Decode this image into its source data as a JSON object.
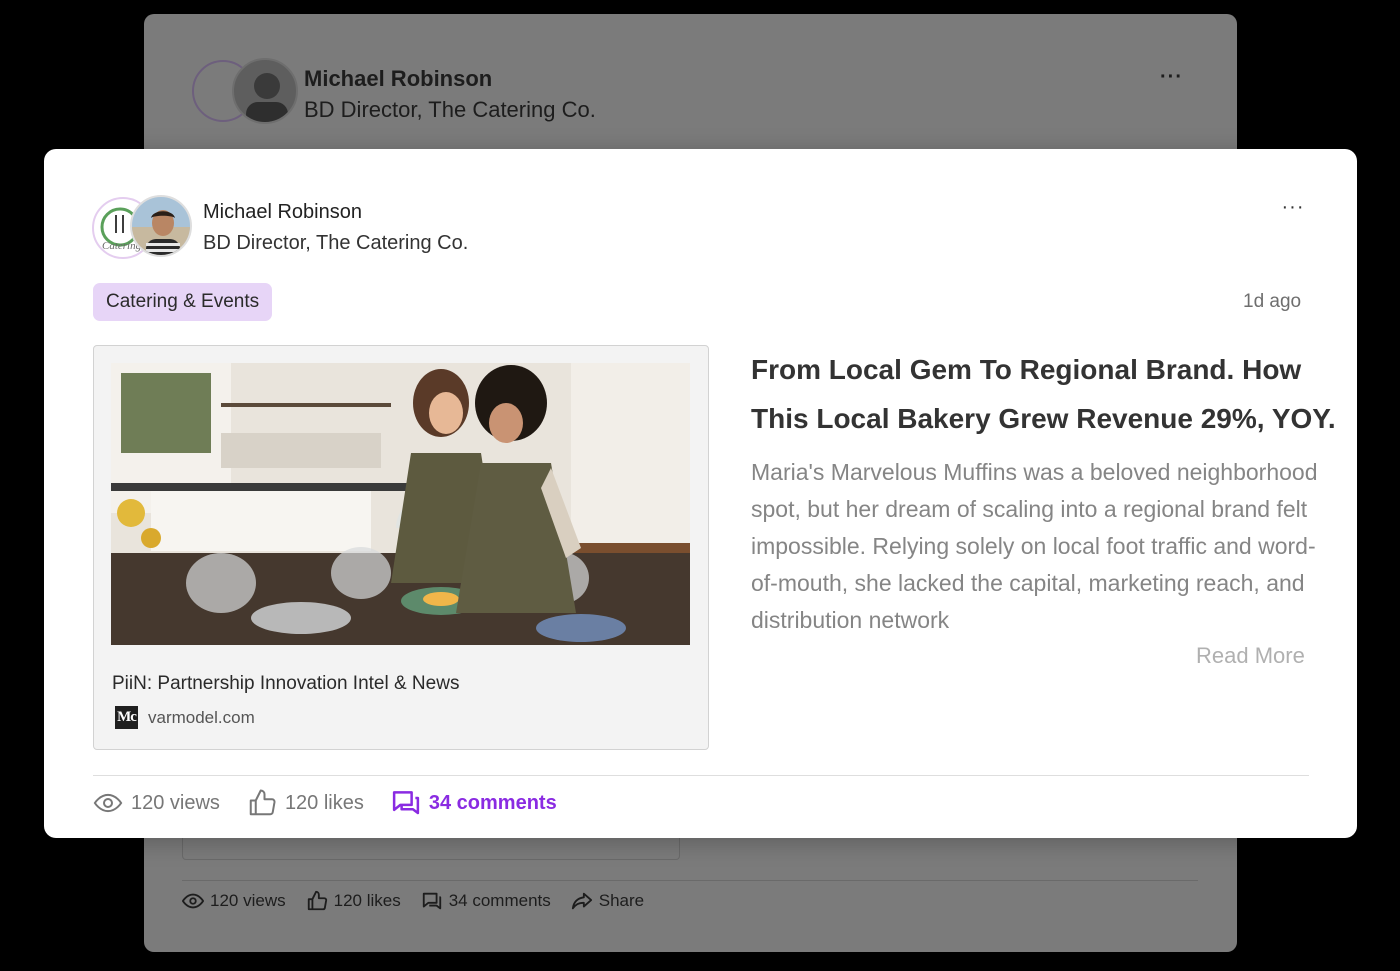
{
  "background_post": {
    "author_name": "Michael Robinson",
    "author_title": "BD Director, The Catering Co.",
    "menu_label": "···",
    "stats": {
      "views": "120 views",
      "likes": "120 likes",
      "comments": "34 comments",
      "share": "Share"
    }
  },
  "post": {
    "author_name": "Michael Robinson",
    "author_title": "BD Director, The Catering Co.",
    "logo_text": "Catering",
    "menu_label": "···",
    "tag": "Catering & Events",
    "timestamp": "1d ago",
    "link": {
      "title": "PiiN: Partnership Innovation Intel & News",
      "source_icon_text": "Mc",
      "source": "varmodel.com"
    },
    "headline": "From Local Gem To Regional Brand.  How This Local Bakery Grew Revenue 29%, YOY.",
    "excerpt": "Maria's Marvelous Muffins was a beloved neighborhood spot, but her dream of scaling into a regional brand felt impossible. Relying solely on local foot traffic and word-of-mouth, she lacked the capital, marketing reach, and distribution network",
    "read_more": "Read More",
    "stats": {
      "views": "120 views",
      "likes": "120 likes",
      "comments": "34 comments"
    },
    "colors": {
      "tag_bg": "#e7d5f7",
      "comments_accent": "#8a2be2",
      "logo_green": "#5aa05a"
    }
  }
}
